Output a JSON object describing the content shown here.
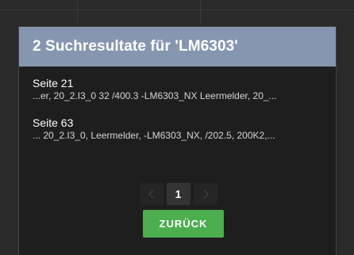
{
  "dialog": {
    "title": "2 Suchresultate für 'LM6303'",
    "header_color": "#8696b0",
    "results": [
      {
        "page": "Seite 21",
        "snippet": "...er, 20_2.I3_0 32 /400.3 -LM6303_NX Leermelder, 20_..."
      },
      {
        "page": "Seite 63",
        "snippet": "... 20_2.I3_0, Leermelder, -LM6303_NX, /202.5, 200K2,..."
      }
    ],
    "pagination": {
      "prev_icon": "chevron-left-icon",
      "current_page": "1",
      "next_icon": "chevron-right-icon"
    },
    "back_button": {
      "label": "ZURÜCK",
      "color": "#4cae4f"
    }
  }
}
